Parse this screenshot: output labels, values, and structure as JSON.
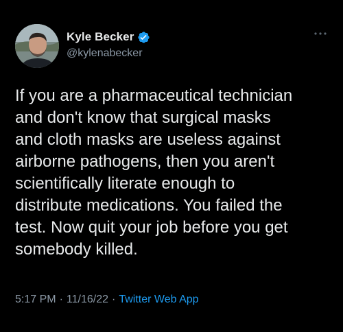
{
  "author": {
    "name": "Kyle Becker",
    "handle": "@kylenabecker",
    "verified_color": "#1d9bf0"
  },
  "menu": {
    "icon": "more-horizontal-icon"
  },
  "tweet": {
    "text": "If you are a pharmaceutical technician\nand don't know that surgical masks\nand cloth masks are useless against\nairborne pathogens, then you aren't\nscientifically literate enough to\ndistribute medications. You failed the\ntest. Now quit your job before you get\nsomebody killed."
  },
  "meta": {
    "time": "5:17 PM",
    "separator": "·",
    "date": "11/16/22",
    "source": "Twitter Web App",
    "source_color": "#1d9bf0"
  },
  "theme": {
    "background": "#000000",
    "text": "#e7e9ea",
    "secondary": "#8b98a5"
  }
}
